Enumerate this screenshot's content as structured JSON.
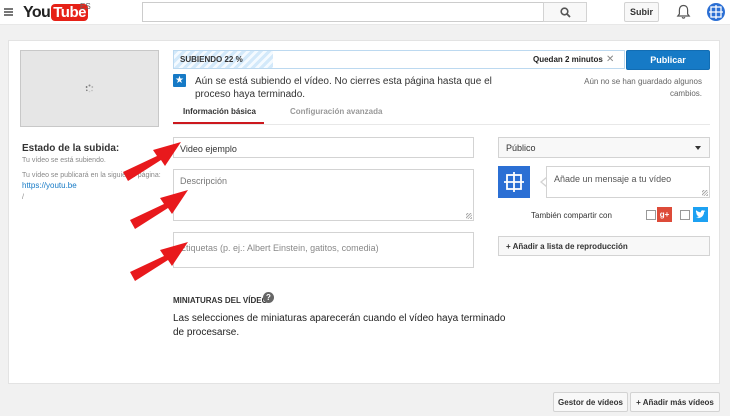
{
  "header": {
    "logo_you": "You",
    "logo_tube": "Tube",
    "region": "ES",
    "search_placeholder": "",
    "upload_label": "Subir"
  },
  "upload": {
    "progress_label": "SUBIENDO 22 %",
    "progress_fraction": 0.22,
    "remaining": "Quedan 2 minutos",
    "publish_label": "Publicar",
    "notice": "Aún se está subiendo el vídeo. No cierres esta página hasta que el proceso haya terminado.",
    "unsaved": "Aún no se han guardado algunos cambios."
  },
  "tabs": [
    {
      "label": "Información básica",
      "active": true
    },
    {
      "label": "Configuración avanzada",
      "active": false
    }
  ],
  "status": {
    "title": "Estado de la subida:",
    "line1": "Tu vídeo se está subiendo.",
    "line2": "Tu vídeo se publicará en la siguiente página:",
    "link": "https://youtu.be",
    "mark": "/"
  },
  "form": {
    "title_value": "Video ejemplo",
    "description_placeholder": "Descripción",
    "tags_placeholder": "Etiquetas (p. ej.: Albert Einstein, gatitos, comedia)"
  },
  "side": {
    "privacy_value": "Público",
    "share_placeholder": "Añade un mensaje a tu vídeo",
    "also_share": "También compartir con",
    "gplus_label": "g+",
    "add_to_playlist": "+ Añadir a lista de reproducción"
  },
  "thumbnails": {
    "title": "MINIATURAS DEL VÍDEO",
    "help": "?",
    "message": "Las selecciones de miniaturas aparecerán cuando el vídeo haya terminado de procesarse."
  },
  "footer": {
    "video_manager": "Gestor de vídeos",
    "add_more": "+ Añadir más vídeos"
  },
  "colors": {
    "brand_red": "#e62117",
    "accent_blue": "#167ac6",
    "annotation_arrow": "#e8191c"
  },
  "icons": [
    "menu-icon",
    "search-icon",
    "bell-icon",
    "avatar-icon",
    "spinner-icon",
    "close-icon",
    "star-icon",
    "chevron-down-icon",
    "google-plus-icon",
    "twitter-icon",
    "help-icon"
  ]
}
